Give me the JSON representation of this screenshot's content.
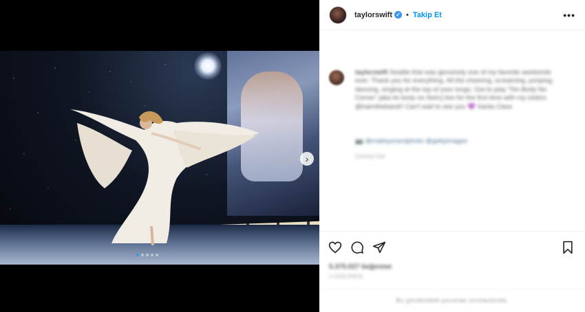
{
  "post": {
    "username": "taylorswift",
    "follow_label": "Takip Et",
    "separator": "•",
    "more_glyph": "•••",
    "verified_glyph": "✓"
  },
  "caption": {
    "username": "taylorswift",
    "text": "Seattle that was genuinely one of my favorite weekends ever. Thank you for everything. All the cheering, screaming, jumping, dancing, singing at the top of your lungs. Got to play 'Tim Body No Corner' (aka its body no Seim) live for the first time with my sisters @haimtheband!! Can't wait to see you 💜 Santa Clara",
    "credits": "📷 @mattsysrandphoto @gettyimages",
    "translate": "Çeviriyi Gör"
  },
  "actions": {
    "like_icon": "heart-icon",
    "comment_icon": "comment-icon",
    "share_icon": "share-icon",
    "save_icon": "bookmark-icon"
  },
  "stats": {
    "likes": "5.375.027 beğenme",
    "time_ago": "2 GÜN ÖNCE"
  },
  "comments_notice": "Bu gönderideki yorumlar sınırlandırıldı.",
  "carousel": {
    "next_glyph": "›",
    "slide_count": 5,
    "active_index": 0
  },
  "colors": {
    "accent": "#0095f6",
    "verified": "#3897f0",
    "text": "#262626",
    "muted": "#8e8e8e"
  }
}
